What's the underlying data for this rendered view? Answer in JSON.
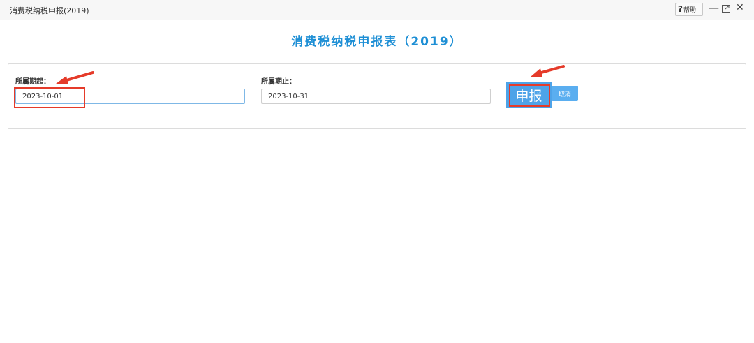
{
  "window": {
    "title": "消费税纳税申报(2019)",
    "help_q": "?",
    "help_label": "帮助",
    "minimize_glyph": "—",
    "close_glyph": "✕"
  },
  "page": {
    "title": "消费税纳税申报表（2019）"
  },
  "form": {
    "start_label": "所属期起：",
    "start_value": "2023-10-01",
    "end_label": "所属期止：",
    "end_value": "2023-10-31",
    "submit_label": "申报",
    "cancel_label": "取消"
  },
  "colors": {
    "accent": "#1e8fd5",
    "button": "#4ea3e8",
    "annotation": "#e53b2a"
  },
  "icons": [
    "help-icon",
    "minimize-icon",
    "maximize-icon",
    "close-icon",
    "annotation-arrow-icon"
  ]
}
